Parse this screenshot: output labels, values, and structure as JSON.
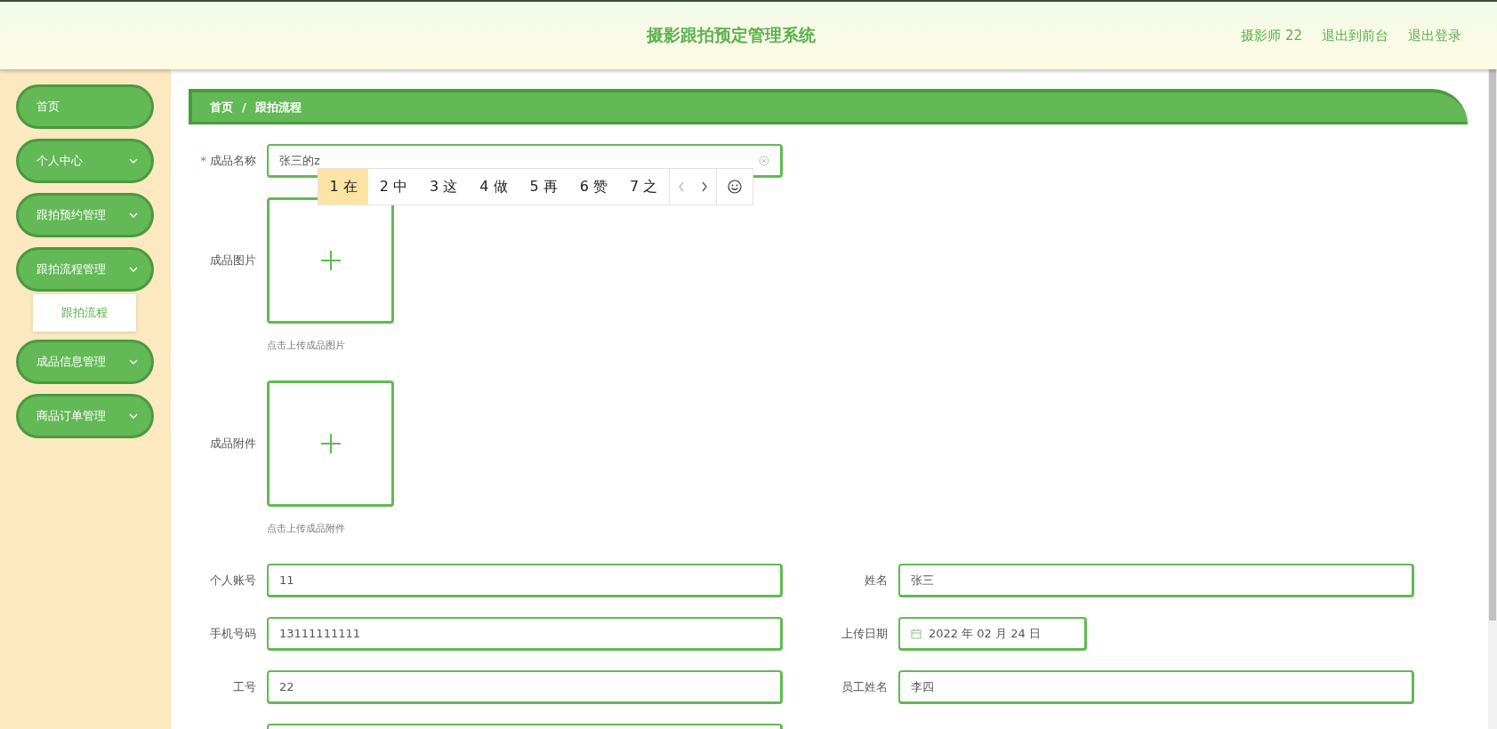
{
  "header": {
    "title": "摄影跟拍预定管理系统",
    "links": [
      "摄影师 22",
      "退出到前台",
      "退出登录"
    ]
  },
  "sidebar": {
    "items": [
      {
        "label": "首页",
        "expandable": false
      },
      {
        "label": "个人中心",
        "expandable": true
      },
      {
        "label": "跟拍预约管理",
        "expandable": true
      },
      {
        "label": "跟拍流程管理",
        "expandable": true,
        "expanded": true,
        "children": [
          {
            "label": "跟拍流程"
          }
        ]
      },
      {
        "label": "成品信息管理",
        "expandable": true
      },
      {
        "label": "商品订单管理",
        "expandable": true
      }
    ]
  },
  "breadcrumb": [
    "首页",
    "/",
    "跟拍流程"
  ],
  "form": {
    "name_field": {
      "label": "成品名称",
      "required": true,
      "required_mark": "*",
      "value": "张三的z",
      "clearable": true
    },
    "ime": {
      "candidates": [
        {
          "label": "1 在",
          "selected": true
        },
        {
          "label": "2 中",
          "selected": false
        },
        {
          "label": "3 这",
          "selected": false
        },
        {
          "label": "4 做",
          "selected": false
        },
        {
          "label": "5 再",
          "selected": false
        },
        {
          "label": "6 赞",
          "selected": false
        },
        {
          "label": "7 之",
          "selected": false
        }
      ]
    },
    "uploads": [
      {
        "label": "成品图片",
        "hint": "点击上传成品图片"
      },
      {
        "label": "成品附件",
        "hint": "点击上传成品附件"
      }
    ],
    "fields": [
      {
        "kind": "text",
        "label": "个人账号",
        "value": "11"
      },
      {
        "kind": "text",
        "label": "姓名",
        "value": "张三"
      },
      {
        "kind": "text",
        "label": "手机号码",
        "value": "13111111111"
      },
      {
        "kind": "date",
        "label": "上传日期",
        "value": "2022 年 02 月 24 日"
      },
      {
        "kind": "text",
        "label": "工号",
        "value": "22"
      },
      {
        "kind": "text",
        "label": "员工姓名",
        "value": "李四"
      },
      {
        "kind": "text"
      }
    ]
  }
}
